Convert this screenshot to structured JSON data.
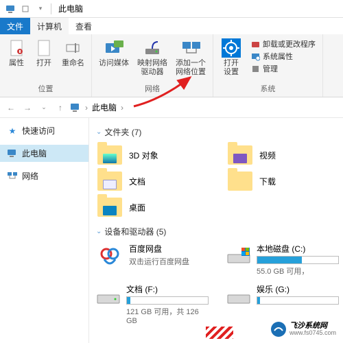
{
  "titlebar": {
    "title": "此电脑"
  },
  "tabs": {
    "file": "文件",
    "computer": "计算机",
    "view": "查看"
  },
  "ribbon": {
    "location_group": "位置",
    "network_group": "网络",
    "system_group": "系统",
    "properties": "属性",
    "open": "打开",
    "rename": "重命名",
    "access_media": "访问媒体",
    "map_drive": "映射网络\n驱动器",
    "add_netloc": "添加一个\n网络位置",
    "open_settings": "打开\n设置",
    "uninstall": "卸载或更改程序",
    "sys_props": "系统属性",
    "manage": "管理"
  },
  "address": {
    "pc": "此电脑"
  },
  "nav": {
    "quick": "快速访问",
    "pc": "此电脑",
    "network": "网络"
  },
  "sections": {
    "folders": "文件夹 (7)",
    "drives": "设备和驱动器 (5)"
  },
  "folders": {
    "obj3d": "3D 对象",
    "videos": "视频",
    "docs": "文档",
    "downloads": "下载",
    "desktop": "桌面"
  },
  "drives": {
    "baidu": {
      "name": "百度网盘",
      "sub": "双击运行百度网盘"
    },
    "c": {
      "name": "本地磁盘 (C:)",
      "sub": "55.0 GB 可用，"
    },
    "f": {
      "name": "文档 (F:)",
      "sub": "121 GB 可用，共 126 GB"
    },
    "g": {
      "name": "娱乐 (G:)"
    }
  },
  "watermark": {
    "name": "飞沙系统网",
    "url": "www.fs0745.com"
  }
}
